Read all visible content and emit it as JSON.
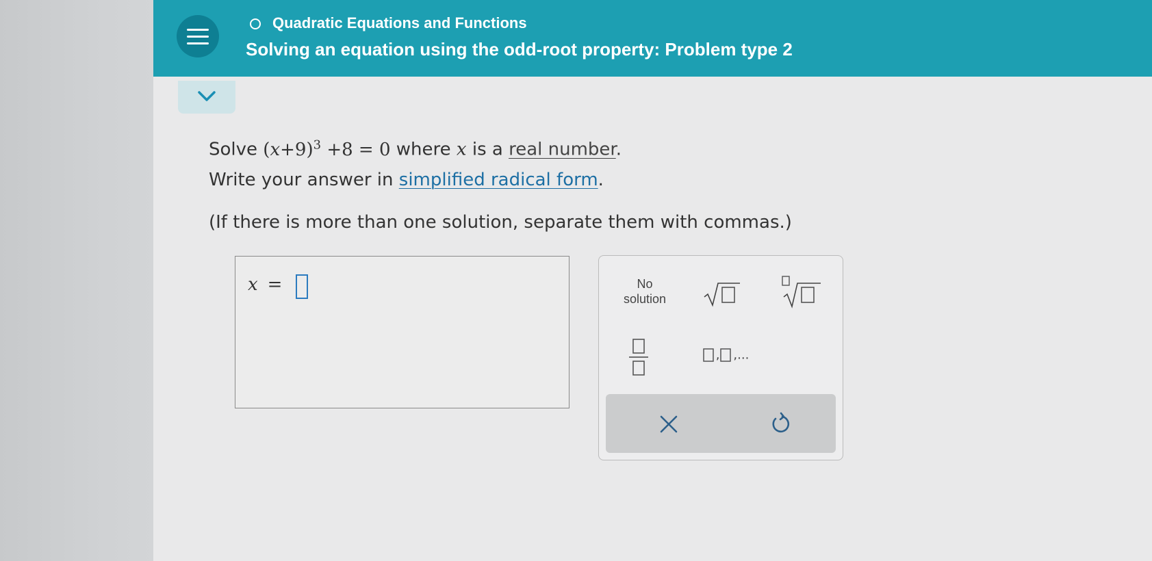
{
  "header": {
    "topic": "Quadratic Equations and Functions",
    "title": "Solving an equation using the odd-root property: Problem type 2",
    "color": "#1d9fb2"
  },
  "question": {
    "solve_word": "Solve",
    "equation_open": "(",
    "equation_var": "x",
    "equation_mid": "+9)",
    "equation_exp": "3",
    "equation_rest": "+8 = 0",
    "where_text": "where",
    "var_x": "x",
    "is_a_text": "is a",
    "real_number_link": "real number",
    "line1_period": ".",
    "line2_prefix": "Write your answer in",
    "simplified_radical_link": "simplified radical form",
    "line2_period": ".",
    "line3": "(If there is more than one solution, separate them with commas.)"
  },
  "answer": {
    "variable": "x",
    "equals": "=",
    "value": ""
  },
  "keypad": {
    "no_solution_line1": "No",
    "no_solution_line2": "solution",
    "list_key_suffix": ",..."
  },
  "icons": {
    "menu": "hamburger-icon",
    "collapse": "chevron-down-icon",
    "clear": "close-icon",
    "undo": "undo-icon"
  }
}
